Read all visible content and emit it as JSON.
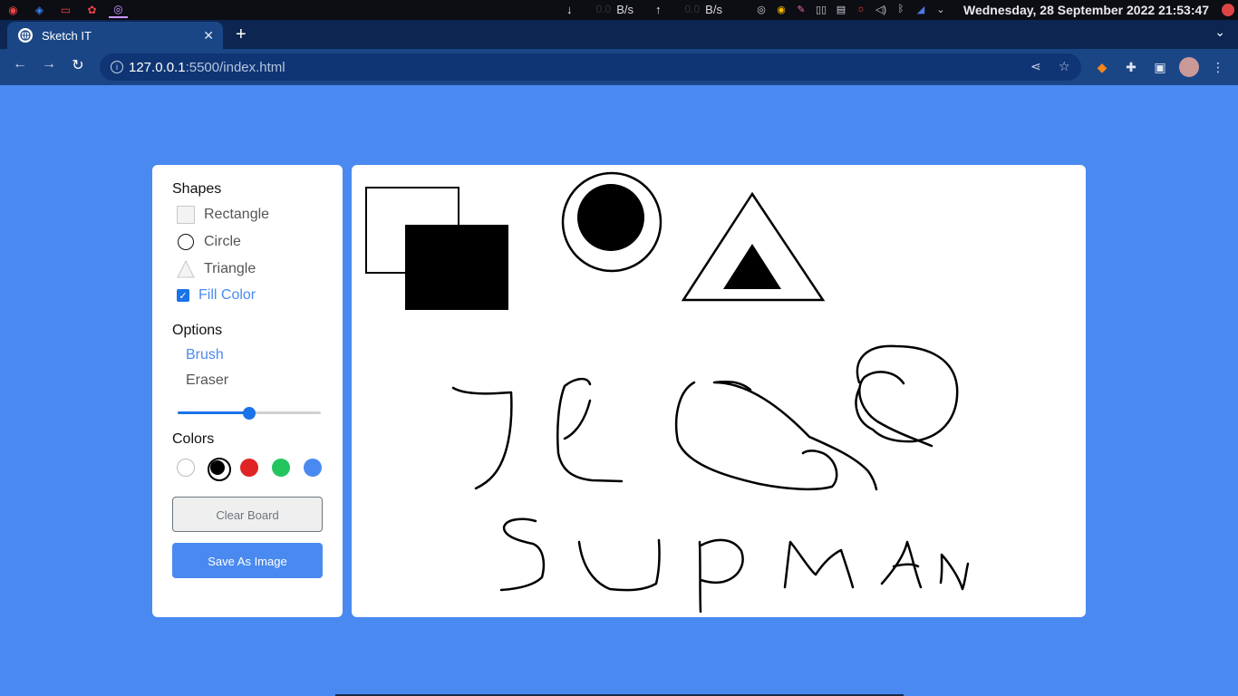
{
  "system": {
    "download_value": "0.0",
    "download_unit": "B/s",
    "upload_value": "0.0",
    "upload_unit": "B/s",
    "clock": "Wednesday, 28 September 2022  21:53:47"
  },
  "browser": {
    "tab_title": "Sketch IT",
    "url_host": "127.0.0.1",
    "url_path": ":5500/index.html"
  },
  "panel": {
    "shapes_title": "Shapes",
    "shapes": [
      "Rectangle",
      "Circle",
      "Triangle"
    ],
    "fill_color_label": "Fill Color",
    "fill_color_checked": true,
    "options_title": "Options",
    "tools": [
      "Brush",
      "Eraser"
    ],
    "active_tool": "Brush",
    "brush_size_fraction": 0.5,
    "colors_title": "Colors",
    "colors": [
      "#ffffff",
      "#000000",
      "#e02424",
      "#22c55e",
      "#4a8af0"
    ],
    "selected_color": "#000000",
    "clear_label": "Clear Board",
    "save_label": "Save As Image"
  },
  "accent": "#4a8af0"
}
